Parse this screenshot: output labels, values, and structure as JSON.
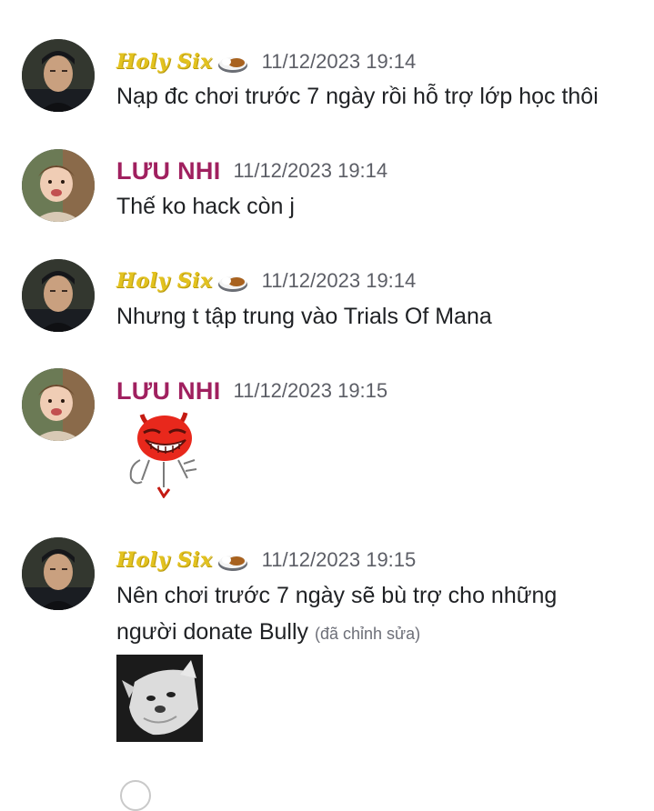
{
  "messages": [
    {
      "author": "Holy Six",
      "time": "11/12/2023 19:14",
      "text": "Nạp đc chơi trước 7 ngày rồi hỗ trợ lớp học thôi"
    },
    {
      "author": "LƯU NHI",
      "time": "11/12/2023 19:14",
      "text": "Thế ko hack còn j"
    },
    {
      "author": "Holy Six",
      "time": "11/12/2023 19:14",
      "text": "Nhưng t tập trung vào Trials Of Mana"
    },
    {
      "author": "LƯU NHI",
      "time": "11/12/2023 19:15",
      "sticker": "troll-devil-sticker"
    },
    {
      "author": "Holy Six",
      "time": "11/12/2023 19:15",
      "text_line1": "Nên chơi trước 7 ngày sẽ bù trợ cho những",
      "text_line2": "người donate Bully",
      "edited": "(đã chỉnh sửa)",
      "attachment": "cat-gif"
    }
  ],
  "icons": {
    "author_badge": "curry-rice-emoji"
  },
  "colors": {
    "holy_name": "#e3c21f",
    "luu_name": "#a0205f",
    "timestamp": "#5c5e66"
  }
}
